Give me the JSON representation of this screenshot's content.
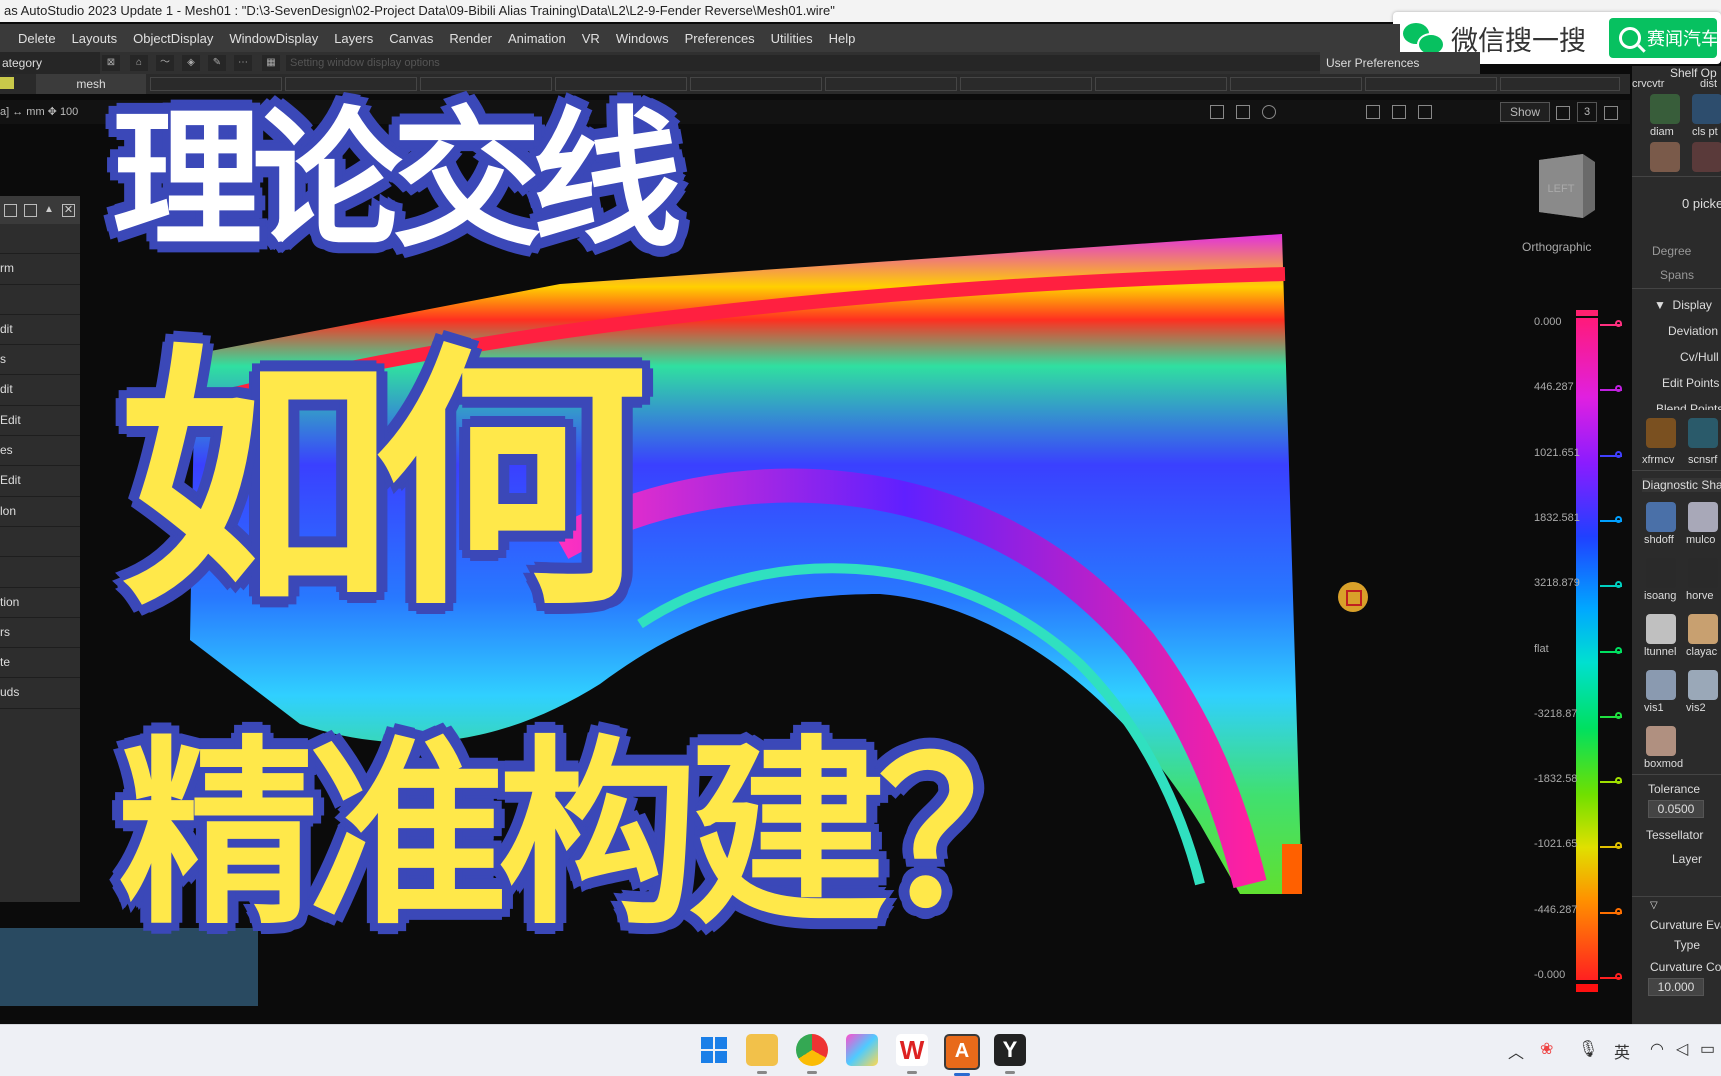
{
  "window": {
    "title": "as AutoStudio 2023 Update 1    - Mesh01 : \"D:\\3-SevenDesign\\02-Project Data\\09-Bibili Alias Training\\Data\\L2\\L2-9-Fender Reverse\\Mesh01.wire\""
  },
  "wechat": {
    "label": "微信搜一搜",
    "search_label": "赛闻汽车"
  },
  "menu": [
    "Delete",
    "Layouts",
    "ObjectDisplay",
    "WindowDisplay",
    "Layers",
    "Canvas",
    "Render",
    "Animation",
    "VR",
    "Windows",
    "Preferences",
    "Utilities",
    "Help"
  ],
  "toolbar": {
    "category": "ategory",
    "hint": "Setting window display options",
    "user_pref": "User Preferences"
  },
  "layer": {
    "name": "mesh"
  },
  "viewport": {
    "units": "a] ↔ mm  ✥ 100",
    "show_label": "Show",
    "view_count": "3",
    "cube_label": "LEFT",
    "projection": "Orthographic"
  },
  "left_panel": {
    "items": [
      "",
      "rm",
      "",
      "dit",
      "s",
      "dit",
      "Edit",
      "es",
      "Edit",
      "lon",
      "",
      "",
      "tion",
      "rs",
      "te",
      "uds"
    ]
  },
  "scale": {
    "labels": [
      "0.000",
      "446.287",
      "1021.651",
      "1832.581",
      "3218.879",
      "flat",
      "-3218.87",
      "-1832.58",
      "-1021.65",
      "-446.287",
      "-0.000"
    ],
    "tick_colors": [
      "#ff3080",
      "#c020e0",
      "#4040ff",
      "#00a0ff",
      "#00d0c0",
      "#00e060",
      "#20e040",
      "#a0e000",
      "#e0c000",
      "#ff7000",
      "#ff2020"
    ]
  },
  "right_panel": {
    "shelf_title": "Shelf Op",
    "top_labels": [
      "crvcvtr",
      "dist"
    ],
    "diam": "diam",
    "clspt": "cls pt",
    "picked": "0 picke",
    "degree": "Degree",
    "spans": "Spans",
    "display": "Display",
    "deviation": "Deviation",
    "cvhull": "Cv/Hull",
    "edit_points": "Edit Points",
    "blend_points": "Blend Points",
    "xfrmcv": "xfrmcv",
    "scnsrf": "scnsrf",
    "diagnostic": "Diagnostic Sha",
    "icons": [
      "shdoff",
      "mulco",
      "isoang",
      "horve",
      "ltunnel",
      "clayac",
      "vis1",
      "vis2",
      "boxmod"
    ],
    "tolerance": "Tolerance",
    "tolerance_value": "0.0500",
    "tessellator": "Tessellator",
    "layer": "Layer",
    "curvature_eval": "Curvature Eva",
    "type": "Type",
    "curvature_co": "Curvature Co",
    "curvature_value": "10.000"
  },
  "overlay": {
    "line1": "理论交线",
    "line2": "如何",
    "line3": "精准构建？"
  },
  "taskbar": {
    "tray_ime": "英"
  },
  "colors": {
    "overlay_outline": "#3b48b8",
    "overlay_yellow": "#ffe84a",
    "overlay_white": "#ffffff"
  }
}
